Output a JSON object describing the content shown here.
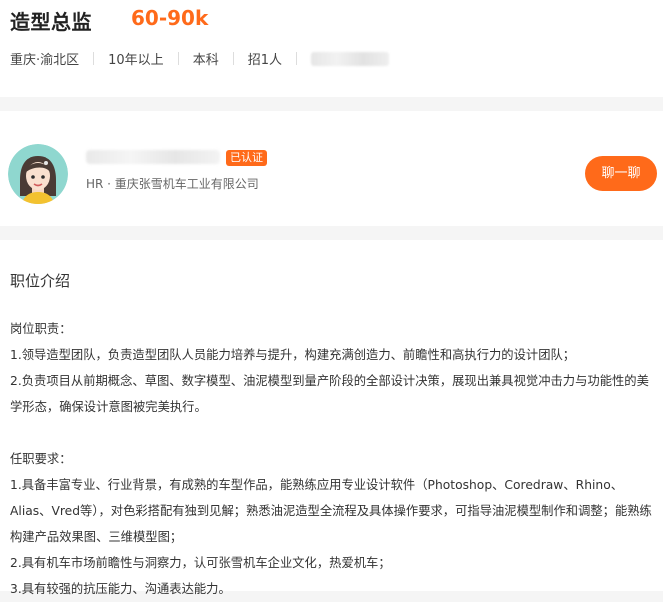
{
  "job": {
    "title": "造型总监",
    "salary": "60-90k",
    "meta": [
      "重庆·渝北区",
      "10年以上",
      "本科",
      "招1人"
    ]
  },
  "recruiter": {
    "verified_badge": "已认证",
    "company_line": "HR · 重庆张雪机车工业有限公司",
    "chat_button": "聊一聊"
  },
  "description": {
    "section_title": "职位介绍",
    "duties_heading": "岗位职责：",
    "duties": [
      "1.领导造型团队，负责造型团队人员能力培养与提升，构建充满创造力、前瞻性和高执行力的设计团队；",
      "2.负责项目从前期概念、草图、数字模型、油泥模型到量产阶段的全部设计决策，展现出兼具视觉冲击力与功能性的美学形态，确保设计意图被完美执行。"
    ],
    "requirements_heading": "任职要求：",
    "requirements": [
      "1.具备丰富专业、行业背景，有成熟的车型作品，能熟练应用专业设计软件（Photoshop、Coredraw、Rhino、Alias、Vred等），对色彩搭配有独到见解；熟悉油泥造型全流程及具体操作要求，可指导油泥模型制作和调整；能熟练构建产品效果图、三维模型图；",
      "2.具有机车市场前瞻性与洞察力，认可张雪机车企业文化，热爱机车；",
      "3.具有较强的抗压能力、沟通表达能力。"
    ]
  },
  "colors": {
    "accent": "#ff6a1a",
    "background": "#f5f5f5"
  }
}
